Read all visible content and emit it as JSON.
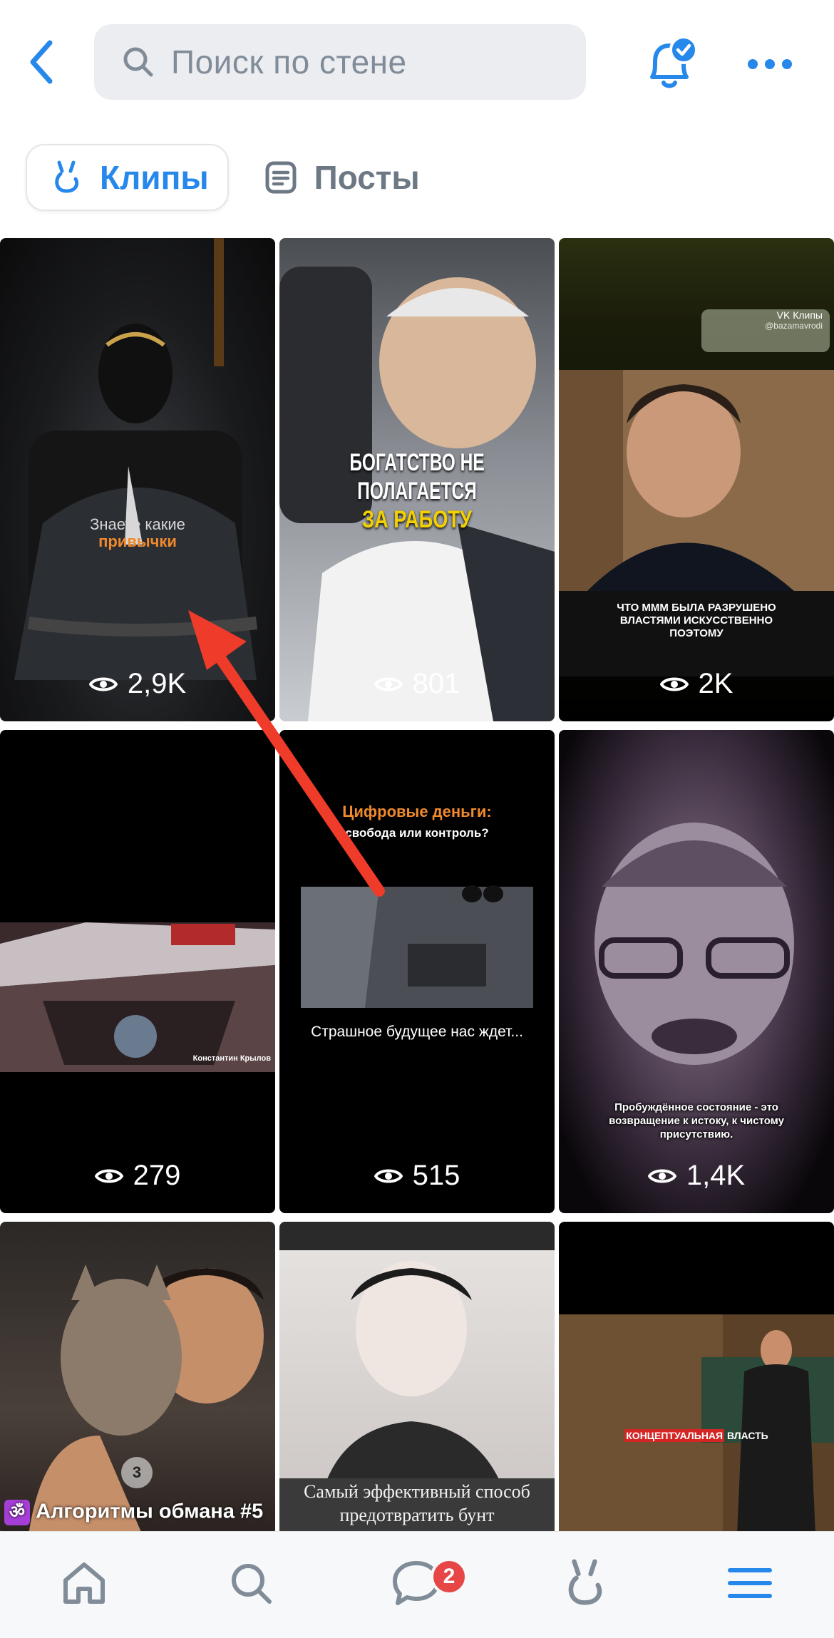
{
  "header": {
    "search_placeholder": "Поиск по стене"
  },
  "tabs": [
    {
      "label": "Клипы",
      "active": true
    },
    {
      "label": "Посты",
      "active": false
    }
  ],
  "clips": [
    {
      "views": "2,9K",
      "caption_line1": "Знаете какие",
      "caption_line2": "привычки"
    },
    {
      "views": "801",
      "caption_line1": "БОГАТСТВО НЕ ПОЛАГАЕТСЯ",
      "caption_line2": "ЗА РАБОТУ"
    },
    {
      "views": "2K",
      "badge": "VK Клипы",
      "handle": "@bazamavrodi",
      "caption": "ЧТО МММ БЫЛА РАЗРУШЕНО ВЛАСТЯМИ ИСКУССТВЕННО ПОЭТОМУ"
    },
    {
      "views": "279",
      "name_tag": "Константин Крылов"
    },
    {
      "views": "515",
      "title": "Цифровые деньги:",
      "subtitle": "свобода или контроль?",
      "caption": "Страшное будущее нас ждет..."
    },
    {
      "views": "1,4K",
      "caption": "Пробуждённое состояние - это возвращение к истоку, к чистому присутствию."
    },
    {
      "caption": "Алгоритмы обмана #5",
      "counter": "3"
    },
    {
      "caption": "Самый эффективный способ предотвратить бунт"
    },
    {
      "caption_red": "КОНЦЕПТУАЛЬНАЯ",
      "caption_white": " ВЛАСТЬ"
    }
  ],
  "navbar": {
    "messages_badge": "2"
  },
  "colors": {
    "accent": "#2688eb",
    "badge": "#e64646",
    "annotation": "#ee3b2a"
  }
}
